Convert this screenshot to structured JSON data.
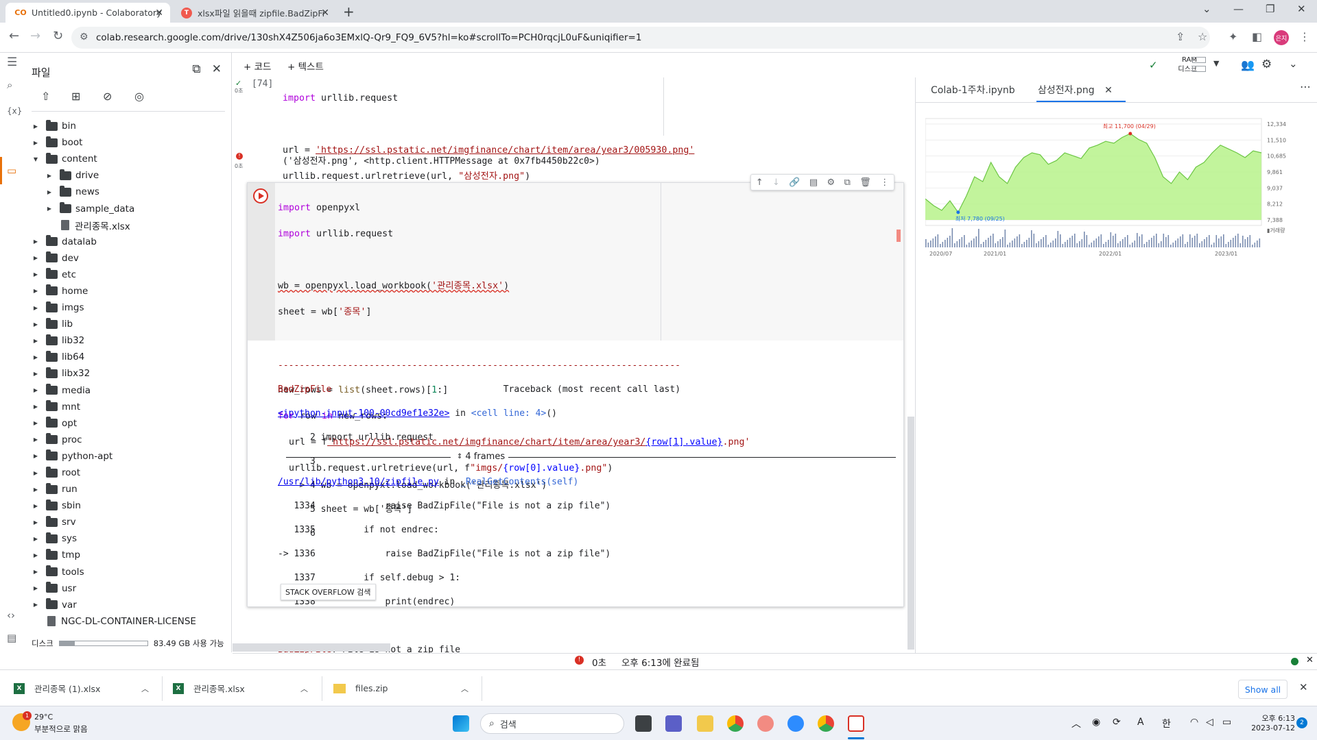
{
  "browser": {
    "tabs": [
      {
        "title": "Untitled0.ipynb - Colaboratory",
        "icon": "colab-icon",
        "active": true
      },
      {
        "title": "xlsx파일 읽을때 zipfile.BadZipFil",
        "icon": "tistory-icon",
        "active": false
      }
    ],
    "url": "colab.research.google.com/drive/130shX4Z506ja6o3EMxlQ-Qr9_FQ9_6V5?hl=ko#scrollTo=PCH0rqcjL0uF&uniqifier=1",
    "profile_initials": "은지"
  },
  "rail": {
    "var_icon": "{x}"
  },
  "files": {
    "title": "파일",
    "tree": [
      {
        "name": "bin",
        "type": "folder",
        "level": 0,
        "expanded": false
      },
      {
        "name": "boot",
        "type": "folder",
        "level": 0,
        "expanded": false
      },
      {
        "name": "content",
        "type": "folder",
        "level": 0,
        "expanded": true
      },
      {
        "name": "drive",
        "type": "folder",
        "level": 1,
        "expanded": false
      },
      {
        "name": "news",
        "type": "folder",
        "level": 1,
        "expanded": false
      },
      {
        "name": "sample_data",
        "type": "folder",
        "level": 1,
        "expanded": false
      },
      {
        "name": "관리종목.xlsx",
        "type": "file",
        "level": 1
      },
      {
        "name": "datalab",
        "type": "folder",
        "level": 0,
        "expanded": false
      },
      {
        "name": "dev",
        "type": "folder",
        "level": 0,
        "expanded": false
      },
      {
        "name": "etc",
        "type": "folder",
        "level": 0,
        "expanded": false
      },
      {
        "name": "home",
        "type": "folder",
        "level": 0,
        "expanded": false
      },
      {
        "name": "imgs",
        "type": "folder",
        "level": 0,
        "expanded": false
      },
      {
        "name": "lib",
        "type": "folder",
        "level": 0,
        "expanded": false
      },
      {
        "name": "lib32",
        "type": "folder",
        "level": 0,
        "expanded": false
      },
      {
        "name": "lib64",
        "type": "folder",
        "level": 0,
        "expanded": false
      },
      {
        "name": "libx32",
        "type": "folder",
        "level": 0,
        "expanded": false
      },
      {
        "name": "media",
        "type": "folder",
        "level": 0,
        "expanded": false
      },
      {
        "name": "mnt",
        "type": "folder",
        "level": 0,
        "expanded": false
      },
      {
        "name": "opt",
        "type": "folder",
        "level": 0,
        "expanded": false
      },
      {
        "name": "proc",
        "type": "folder",
        "level": 0,
        "expanded": false
      },
      {
        "name": "python-apt",
        "type": "folder",
        "level": 0,
        "expanded": false
      },
      {
        "name": "root",
        "type": "folder",
        "level": 0,
        "expanded": false
      },
      {
        "name": "run",
        "type": "folder",
        "level": 0,
        "expanded": false
      },
      {
        "name": "sbin",
        "type": "folder",
        "level": 0,
        "expanded": false
      },
      {
        "name": "srv",
        "type": "folder",
        "level": 0,
        "expanded": false
      },
      {
        "name": "sys",
        "type": "folder",
        "level": 0,
        "expanded": false
      },
      {
        "name": "tmp",
        "type": "folder",
        "level": 0,
        "expanded": false
      },
      {
        "name": "tools",
        "type": "folder",
        "level": 0,
        "expanded": false
      },
      {
        "name": "usr",
        "type": "folder",
        "level": 0,
        "expanded": false
      },
      {
        "name": "var",
        "type": "folder",
        "level": 0,
        "expanded": false
      },
      {
        "name": "NGC-DL-CONTAINER-LICENSE",
        "type": "file",
        "level": 0
      }
    ],
    "disk_label": "디스크",
    "disk_free": "83.49 GB 사용 가능",
    "disk_used_fraction": 0.17
  },
  "toolbar": {
    "add_code": "+ 코드",
    "add_text": "+ 텍스트",
    "ram_label": "RAM",
    "disk_label": "디스크"
  },
  "cell1": {
    "exec_count": "[74]",
    "time": "0초",
    "import_kw": "import",
    "import_mod": " urllib.request",
    "url_var": "url = ",
    "url_str": "'https://ssl.pstatic.net/imgfinance/chart/item/area/year3/005930.png'",
    "call_line": "urllib.request.urlretrieve(url, ",
    "call_arg": "\"삼성전자.png\"",
    "call_end": ")",
    "output": "('삼성전자.png', <http.client.HTTPMessage at 0x7fb4450b22c0>)"
  },
  "cell2": {
    "time": "0초",
    "l1_kw": "import",
    "l1": " openpyxl",
    "l2_kw": "import",
    "l2": " urllib.request",
    "l3a": "wb = openpyxl.load_workbook(",
    "l3s": "'관리종목.xlsx'",
    "l3b": ")",
    "l4a": "sheet = wb[",
    "l4s": "'종목'",
    "l4b": "]",
    "l5a": "new_rows = ",
    "l5f": "list",
    "l5b": "(sheet.rows)[",
    "l5n": "1",
    "l5c": ":]",
    "l6kw": "for",
    "l6a": " row ",
    "l6in": "in",
    "l6b": " new_rows:",
    "l7a": "  url = f",
    "l7s": "'https://ssl.pstatic.net/imgfinance/chart/item/area/year3/",
    "l7x": "{row[1].value}",
    "l7e": ".png'",
    "l8a": "  urllib.request.urlretrieve(url, f",
    "l8s": "\"imgs/",
    "l8x": "{row[0].value}",
    "l8e": ".png\"",
    "l8b": ")"
  },
  "error": {
    "dashes": "---------------------------------------------------------------------------",
    "name": "BadZipFile",
    "traceback_hdr": "                                Traceback (most recent call last)",
    "input_link": "<ipython-input-100-00cd9ef1e32e>",
    "in_word": " in ",
    "cell_line": "<cell line: 4>",
    "cell_end": "()",
    "t2": "      2 import urllib.request",
    "t3": "      3",
    "t4": "----> 4 wb = openpyxl.load_workbook('관리종목.xlsx')",
    "t5": "      5 sheet = wb['종목']",
    "t6": "      6",
    "frames": "4 frames",
    "zip_link": "/usr/lib/python3.10/zipfile.py",
    "zip_in": " in ",
    "zip_func": "_RealGetContents(self)",
    "z1": "   1334             raise BadZipFile(\"File is not a zip file\")",
    "z2": "   1335         if not endrec:",
    "z3": "-> 1336             raise BadZipFile(\"File is not a zip file\")",
    "z4": "   1337         if self.debug > 1:",
    "z5": "   1338             print(endrec)",
    "final_name": "BadZipFile",
    "final_msg": ": File is not a zip file",
    "so_button": "STACK OVERFLOW 검색"
  },
  "sidepanel": {
    "tabs": [
      "Colab-1주차.ipynb",
      "삼성전자.png"
    ],
    "more_icon": "⋯"
  },
  "chart_data": {
    "type": "area",
    "x_labels": [
      "2020/07",
      "2021/01",
      "2022/01",
      "2023/01"
    ],
    "y_ticks": [
      "12,334",
      "11,510",
      "10,685",
      "9,861",
      "9,037",
      "8,212",
      "7,388"
    ],
    "annotations": [
      "최고 11,700 (04/29)",
      "최저 7,780 (09/25)"
    ],
    "volume_label": "거래량"
  },
  "status": {
    "time": "0초",
    "done": "오후 6:13에 완료됨"
  },
  "downloads": {
    "items": [
      "관리종목 (1).xlsx",
      "관리종목.xlsx",
      "files.zip"
    ],
    "show_all": "Show all"
  },
  "taskbar": {
    "weather_temp": "29°C",
    "weather_desc": "부분적으로 맑음",
    "search": "검색",
    "time": "오후 6:13",
    "date": "2023-07-12",
    "ime_en": "A",
    "ime_ko": "한",
    "notification_count": "2"
  }
}
